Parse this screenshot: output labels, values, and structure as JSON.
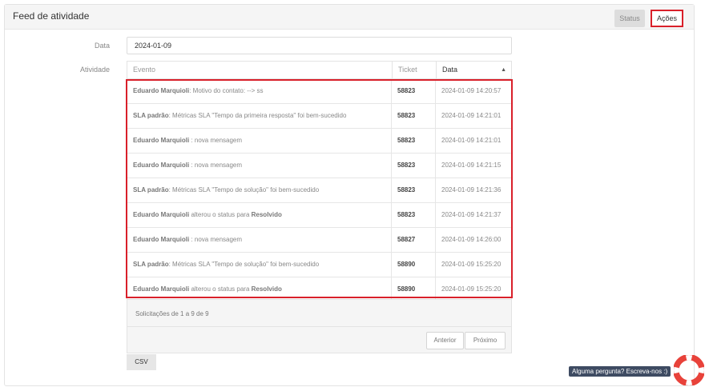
{
  "panel": {
    "title": "Feed de atividade"
  },
  "header_buttons": {
    "status": "Status",
    "acoes": "Ações"
  },
  "filter": {
    "date_label": "Data",
    "date_value": "2024-01-09",
    "activity_label": "Atividade"
  },
  "table": {
    "columns": [
      "Evento",
      "Ticket",
      "Data"
    ],
    "sorted_column": "Data",
    "rows": [
      {
        "actor": "Eduardo Marquioli",
        "text": ": Motivo do contato: --> ss",
        "ticket": "58823",
        "date": "2024-01-09 14:20:57"
      },
      {
        "actor": "SLA padrão",
        "text": ": Métricas SLA \"Tempo da primeira resposta\" foi bem-sucedido",
        "ticket": "58823",
        "date": "2024-01-09 14:21:01"
      },
      {
        "actor": "Eduardo Marquioli",
        "text": " : nova mensagem",
        "ticket": "58823",
        "date": "2024-01-09 14:21:01"
      },
      {
        "actor": "Eduardo Marquioli",
        "text": " : nova mensagem",
        "ticket": "58823",
        "date": "2024-01-09 14:21:15"
      },
      {
        "actor": "SLA padrão",
        "text": ": Métricas SLA \"Tempo de solução\" foi bem-sucedido",
        "ticket": "58823",
        "date": "2024-01-09 14:21:36"
      },
      {
        "actor": "Eduardo Marquioli",
        "text": " alterou o status para ",
        "status": "Resolvido",
        "ticket": "58823",
        "date": "2024-01-09 14:21:37"
      },
      {
        "actor": "Eduardo Marquioli",
        "text": " : nova mensagem",
        "ticket": "58827",
        "date": "2024-01-09 14:26:00"
      },
      {
        "actor": "SLA padrão",
        "text": ": Métricas SLA \"Tempo de solução\" foi bem-sucedido",
        "ticket": "58890",
        "date": "2024-01-09 15:25:20"
      },
      {
        "actor": "Eduardo Marquioli",
        "text": " alterou o status para ",
        "status": "Resolvido",
        "ticket": "58890",
        "date": "2024-01-09 15:25:20"
      }
    ]
  },
  "footer": {
    "summary": "Solicitações de 1 a 9 de 9",
    "prev": "Anterior",
    "next": "Próximo",
    "csv": "CSV"
  },
  "help": {
    "text": "Alguma pergunta? Escreva-nos :)"
  },
  "colors": {
    "highlight": "#d9202a",
    "help_bg": "#3e4b62",
    "lifebuoy_red": "#e8423a"
  },
  "icons": {
    "sort": "caret-up-icon",
    "help": "lifebuoy-icon"
  }
}
